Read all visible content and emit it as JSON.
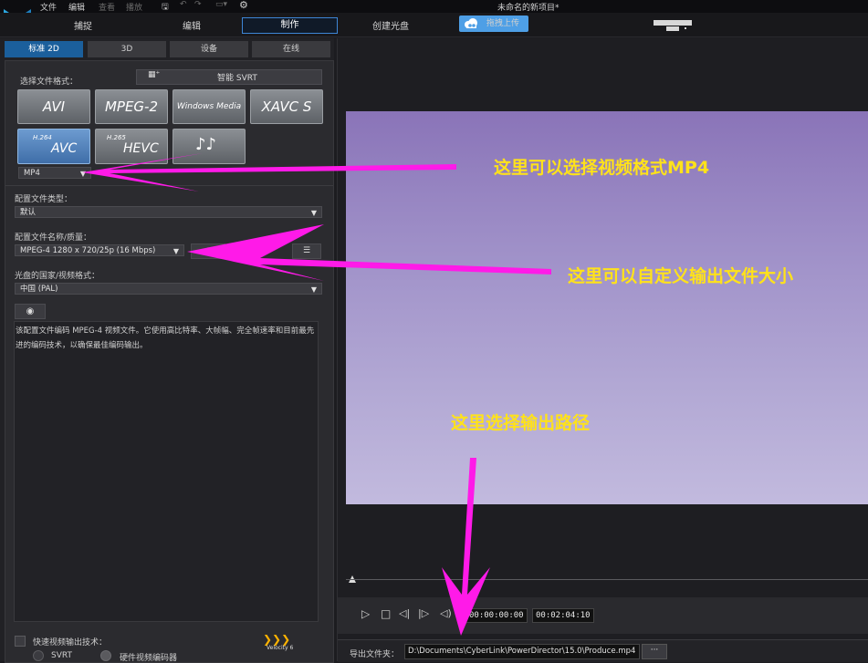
{
  "menu": {
    "file": "文件",
    "edit": "编辑",
    "view": "查看",
    "play": "播放"
  },
  "window_title": "未命名的新项目*",
  "modes": {
    "capture": "捕捉",
    "edit": "编辑",
    "produce": "制作",
    "create_disc": "创建光盘",
    "upload": "拖拽上传"
  },
  "subtabs": [
    "标准 2D",
    "3D",
    "设备",
    "在线"
  ],
  "select_format_label": "选择文件格式：",
  "svrt_label": "智能 SVRT",
  "formats": [
    {
      "name": "AVI",
      "prefix": ""
    },
    {
      "name": "MPEG-2",
      "prefix": ""
    },
    {
      "name": "Windows Media",
      "prefix": ""
    },
    {
      "name": "XAVC S",
      "prefix": ""
    },
    {
      "name": "AVC",
      "prefix": "H.264"
    },
    {
      "name": "HEVC",
      "prefix": "H.265"
    },
    {
      "name": "♪♪",
      "prefix": ""
    }
  ],
  "container_value": "MP4",
  "profile_type_label": "配置文件类型：",
  "profile_type_value": "默认",
  "profile_name_label": "配置文件名称/质量：",
  "profile_name_value": "MPEG-4 1280 x 720/25p (16 Mbps)",
  "region_label": "光盘的国家/视频格式：",
  "region_value": "中国 (PAL)",
  "description": "该配置文件编码 MPEG-4 视频文件。它使用高比特率、大帧幅、完全帧速率和目前最先进的编码技术，以确保最佳编码输出。",
  "fast_render_label": "快速视频输出技术：",
  "svrt_option": "SVRT",
  "hw_encoder_option": "硬件视频编码器",
  "velocity_badge": "Velocity 6",
  "timecode_current": "00:00:00:00",
  "timecode_duration": "00:02:04:10",
  "export_folder_label": "导出文件夹：",
  "export_path": "D:\\Documents\\CyberLink\\PowerDirector\\15.0\\Produce.mp4",
  "browse_label": "···",
  "annotations": {
    "format": "这里可以选择视频格式MP4",
    "size": "这里可以自定义输出文件大小",
    "path": "这里选择输出路径"
  },
  "colors": {
    "accent": "#3d86d6",
    "arrow": "#ff1ae8",
    "annotation_text": "#ffe21a"
  }
}
